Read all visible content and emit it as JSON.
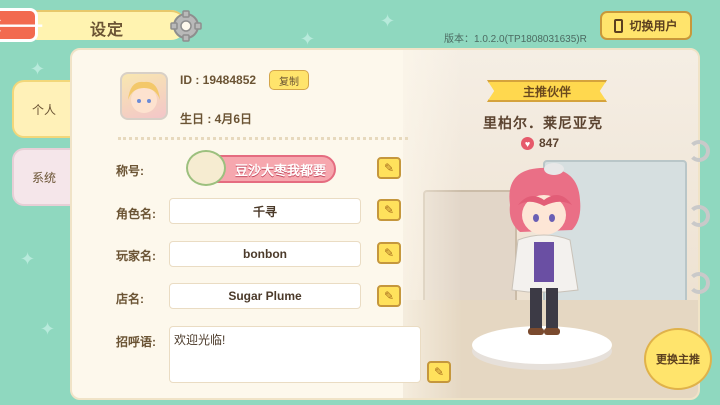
{
  "header": {
    "title": "设定",
    "version": "版本：1.0.2.0(TP1808031635)R",
    "switch_user_label": "切换用户"
  },
  "tabs": [
    {
      "label": "个人",
      "active": true
    },
    {
      "label": "系统",
      "active": false
    }
  ],
  "profile": {
    "id_text": "ID : 19484852",
    "copy_label": "复制",
    "birthday_text": "生日 : 4月6日"
  },
  "fields": {
    "title_label": "称号:",
    "title_badge": "豆沙大枣我都要",
    "role_name_label": "角色名:",
    "role_name_value": "千寻",
    "player_name_label": "玩家名:",
    "player_name_value": "bonbon",
    "shop_name_label": "店名:",
    "shop_name_value": "Sugar Plume",
    "greeting_label": "招呼语:",
    "greeting_value": "欢迎光临!"
  },
  "partner": {
    "ribbon": "主推伙伴",
    "name": "里柏尔．莱尼亚克",
    "affection": "847",
    "change_label": "更换主推"
  },
  "colors": {
    "background": "#8fd8bf",
    "accent_yellow": "#ffe46c",
    "back_button": "#f26a4f",
    "badge_pink": "#f6a7ae"
  }
}
